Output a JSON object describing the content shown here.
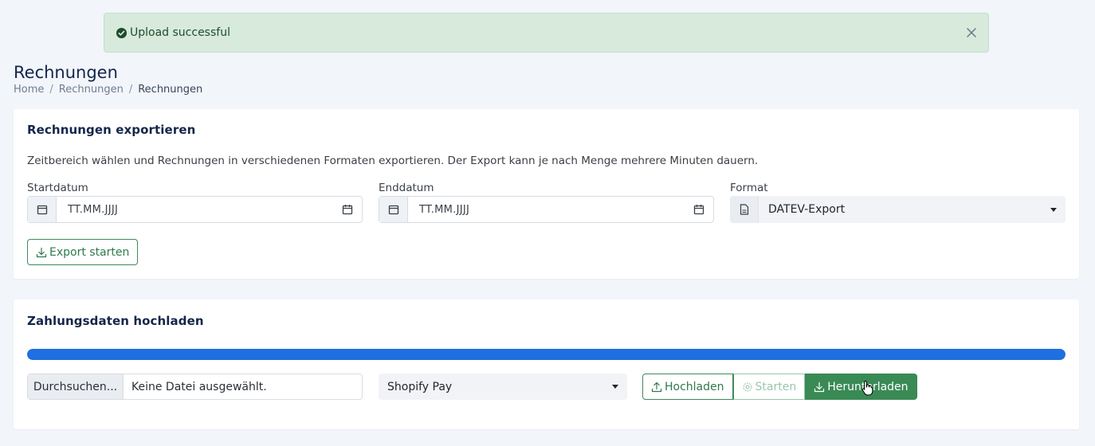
{
  "alert": {
    "message": "Upload successful",
    "color": "#d7eadc"
  },
  "header": {
    "title": "Rechnungen",
    "breadcrumb": [
      "Home",
      "Rechnungen",
      "Rechnungen"
    ]
  },
  "export_card": {
    "title": "Rechnungen exportieren",
    "description": "Zeitbereich wählen und Rechnungen in verschiedenen Formaten exportieren. Der Export kann je nach Menge mehrere Minuten dauern.",
    "start_label": "Startdatum",
    "start_placeholder": "TT.MM.JJJJ",
    "end_label": "Enddatum",
    "end_placeholder": "TT.MM.JJJJ",
    "format_label": "Format",
    "format_value": "DATEV-Export",
    "export_button": "Export starten"
  },
  "upload_card": {
    "title": "Zahlungsdaten hochladen",
    "progress_percent": 100,
    "browse_button": "Durchsuchen...",
    "file_name": "Keine Datei ausgewählt.",
    "provider_value": "Shopify Pay",
    "upload_button": "Hochladen",
    "start_button": "Starten",
    "download_button": "Herunterladen"
  },
  "colors": {
    "accent_green": "#3a8a55",
    "progress_blue": "#1e6fe0",
    "title_navy": "#14264a"
  },
  "icons": [
    "check-circle-icon",
    "close-icon",
    "calendar-icon",
    "document-icon",
    "caret-down-icon",
    "download-icon",
    "upload-icon",
    "gear-icon",
    "hand-cursor-icon"
  ]
}
